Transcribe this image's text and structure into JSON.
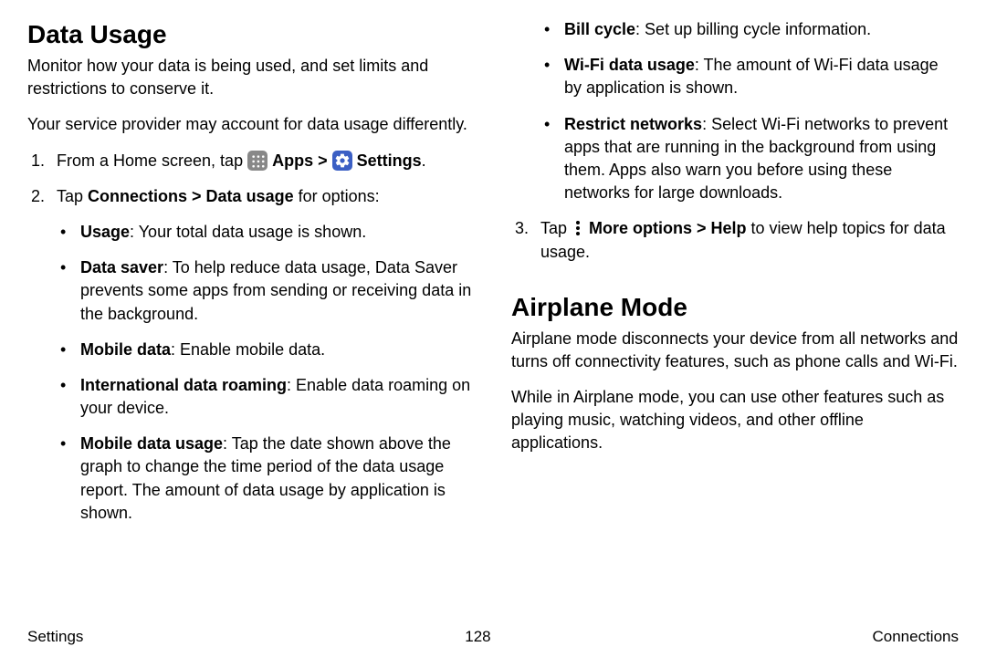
{
  "dataUsage": {
    "heading": "Data Usage",
    "intro1": "Monitor how your data is being used, and set limits and restrictions to conserve it.",
    "intro2": "Your service provider may account for data usage differently.",
    "step1_pre": "From a Home screen, tap ",
    "apps_label": " Apps",
    "gt": " > ",
    "settings_label": " Settings",
    "step1_post": ".",
    "step2_pre": "Tap ",
    "step2_bold": "Connections > Data usage",
    "step2_post": " for options:",
    "usage_b": "Usage",
    "usage_t": ": Your total data usage is shown.",
    "saver_b": "Data saver",
    "saver_t": ": To help reduce data usage, Data Saver prevents some apps from sending or receiving data in the background.",
    "mobile_b": "Mobile data",
    "mobile_t": ": Enable mobile data.",
    "intl_b": "International data roaming",
    "intl_t": ": Enable data roaming on your device.",
    "mdu_b": "Mobile data usage",
    "mdu_t": ": Tap the date shown above the graph to change the time period of the data usage report. The amount of data usage by application is shown.",
    "bill_b": "Bill cycle",
    "bill_t": ": Set up billing cycle information.",
    "wifi_b": "Wi-Fi data usage",
    "wifi_t": ": The amount of Wi-Fi data usage by application is shown.",
    "restrict_b": "Restrict networks",
    "restrict_t": ": Select Wi-Fi networks to prevent apps that are running in the background from using them. Apps also warn you before using these networks for large downloads.",
    "step3_pre": "Tap ",
    "step3_bold": " More options > Help",
    "step3_post": " to view help topics for data usage."
  },
  "airplane": {
    "heading": "Airplane Mode",
    "p1": "Airplane mode disconnects your device from all networks and turns off connectivity features, such as phone calls and Wi-Fi.",
    "p2": "While in Airplane mode, you can use other features such as playing music, watching videos, and other offline applications."
  },
  "footer": {
    "left": "Settings",
    "page": "128",
    "right": "Connections"
  }
}
